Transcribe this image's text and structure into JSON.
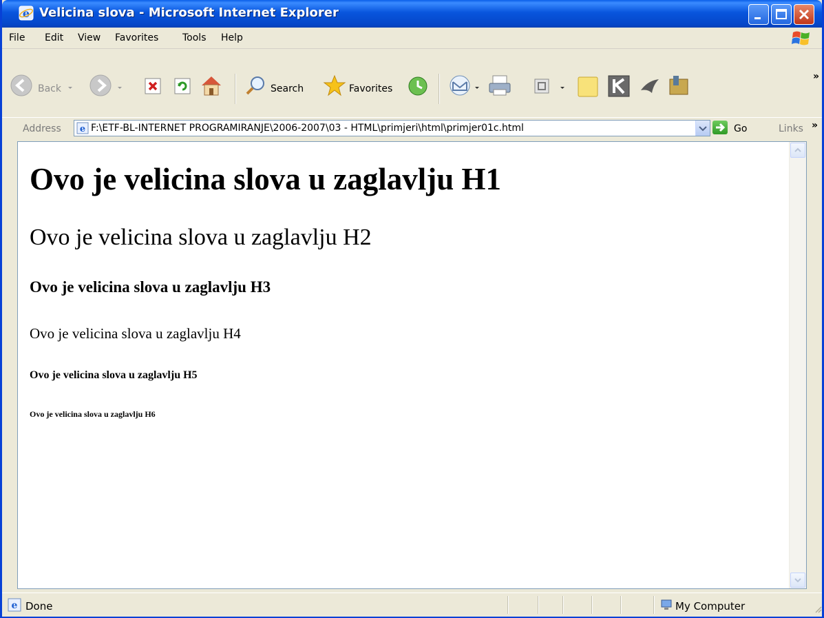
{
  "window": {
    "title": "Velicina slova - Microsoft Internet Explorer"
  },
  "menu": {
    "items": [
      "File",
      "Edit",
      "View",
      "Favorites",
      "Tools",
      "Help"
    ]
  },
  "toolbar": {
    "back_label": "Back",
    "search_label": "Search",
    "favorites_label": "Favorites",
    "overflow": "»"
  },
  "address": {
    "label": "Address",
    "url": "F:\\ETF-BL-INTERNET PROGRAMIRANJE\\2006-2007\\03 - HTML\\primjeri\\html\\primjer01c.html",
    "go_label": "Go",
    "links_label": "Links",
    "links_overflow": "»"
  },
  "page": {
    "h1": "Ovo je velicina slova u zaglavlju H1",
    "h2": "Ovo je velicina slova u zaglavlju H2",
    "h3": "Ovo je velicina slova u zaglavlju H3",
    "h4": "Ovo je velicina slova u zaglavlju H4",
    "h5": "Ovo je velicina slova u zaglavlju H5",
    "h6": "Ovo je velicina slova u zaglavlju H6"
  },
  "status": {
    "text": "Done",
    "zone": "My Computer"
  },
  "colors": {
    "titlebar": "#0855DD",
    "chrome": "#ECE9D8",
    "go_green": "#2F9A26"
  }
}
